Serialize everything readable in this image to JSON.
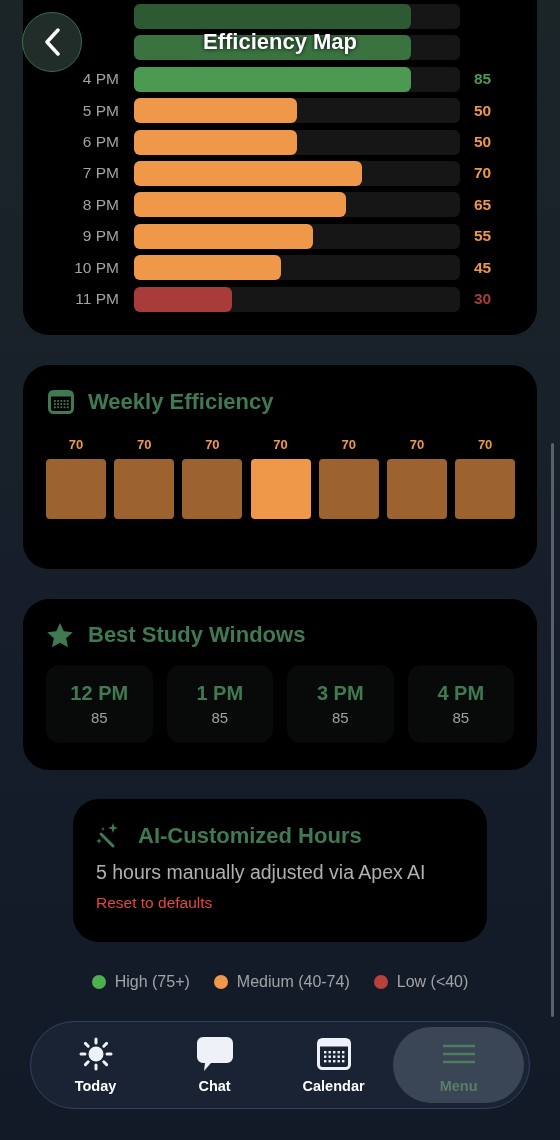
{
  "header": {
    "title": "Efficiency Map"
  },
  "hourly": {
    "rows": [
      {
        "level": 0.85,
        "color": "#2e5a33"
      },
      {
        "level": 0.85,
        "color": "#3a7340"
      },
      {
        "label": "4 PM",
        "value": "85",
        "level": 0.85,
        "color": "#4c9a52"
      },
      {
        "label": "5 PM",
        "value": "50",
        "level": 0.5,
        "color": "#f0984a"
      },
      {
        "label": "6 PM",
        "value": "50",
        "level": 0.5,
        "color": "#f0984a"
      },
      {
        "label": "7 PM",
        "value": "70",
        "level": 0.7,
        "color": "#f0984a"
      },
      {
        "label": "8 PM",
        "value": "65",
        "level": 0.65,
        "color": "#f0984a"
      },
      {
        "label": "9 PM",
        "value": "55",
        "level": 0.55,
        "color": "#f0984a"
      },
      {
        "label": "10 PM",
        "value": "45",
        "level": 0.45,
        "color": "#f0984a"
      },
      {
        "label": "11 PM",
        "value": "30",
        "level": 0.3,
        "color": "#a83c3a"
      }
    ]
  },
  "weekly": {
    "title": "Weekly Efficiency",
    "days": [
      {
        "value": "70",
        "selected": false
      },
      {
        "value": "70",
        "selected": false
      },
      {
        "value": "70",
        "selected": false
      },
      {
        "value": "70",
        "selected": true
      },
      {
        "value": "70",
        "selected": false
      },
      {
        "value": "70",
        "selected": false
      },
      {
        "value": "70",
        "selected": false
      }
    ]
  },
  "best_windows": {
    "title": "Best Study Windows",
    "slots": [
      {
        "time": "12 PM",
        "score": "85"
      },
      {
        "time": "1 PM",
        "score": "85"
      },
      {
        "time": "3 PM",
        "score": "85"
      },
      {
        "time": "4 PM",
        "score": "85"
      }
    ]
  },
  "ai_card": {
    "title": "AI-Customized Hours",
    "text": "5 hours manually adjusted via Apex AI",
    "link": "Reset to defaults"
  },
  "legend": [
    {
      "label": "High (75+)",
      "color": "#4caf50"
    },
    {
      "label": "Medium (40-74)",
      "color": "#f0984a"
    },
    {
      "label": "Low (<40)",
      "color": "#b8413c"
    }
  ],
  "tabs": [
    {
      "label": "Today",
      "kind": "sun",
      "selected": false
    },
    {
      "label": "Chat",
      "kind": "chat",
      "selected": false
    },
    {
      "label": "Calendar",
      "kind": "calendar",
      "selected": false
    },
    {
      "label": "Menu",
      "kind": "menu",
      "selected": true
    }
  ]
}
